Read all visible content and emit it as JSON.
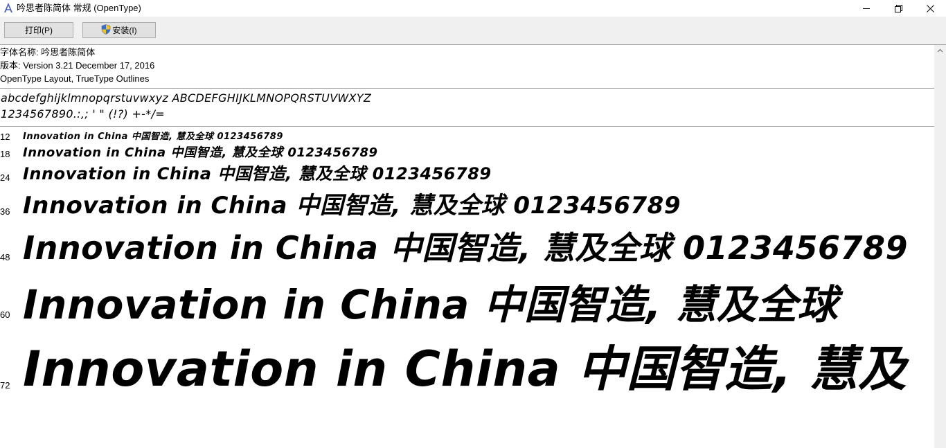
{
  "window": {
    "title": "吟思者陈简体 常规 (OpenType)",
    "minimize_icon": "minimize-icon",
    "maximize_icon": "restore-icon",
    "close_icon": "close-icon"
  },
  "toolbar": {
    "print_label": "打印(P)",
    "install_label": "安装(I)",
    "install_icon": "uac-shield-icon"
  },
  "font_info": {
    "name_line": "字体名称: 吟思者陈简体",
    "version_line": "版本: Version 3.21 December 17, 2016",
    "outline_line": "OpenType Layout, TrueType Outlines"
  },
  "charset": {
    "letters": "abcdefghijklmnopqrstuvwxyz ABCDEFGHIJKLMNOPQRSTUVWXYZ",
    "digits_symbols": "1234567890.:,; ' \" (!?) +-*/="
  },
  "samples": [
    {
      "size": "12",
      "text": "Innovation in China 中国智造, 慧及全球 0123456789"
    },
    {
      "size": "18",
      "text": "Innovation in China 中国智造, 慧及全球 0123456789"
    },
    {
      "size": "24",
      "text": "Innovation in China 中国智造, 慧及全球 0123456789"
    },
    {
      "size": "36",
      "text": "Innovation in China 中国智造, 慧及全球 0123456789"
    },
    {
      "size": "48",
      "text": "Innovation in China 中国智造, 慧及全球 0123456789"
    },
    {
      "size": "60",
      "text": "Innovation in China 中国智造, 慧及全球"
    },
    {
      "size": "72",
      "text": "Innovation in China 中国智造, 慧及"
    }
  ]
}
